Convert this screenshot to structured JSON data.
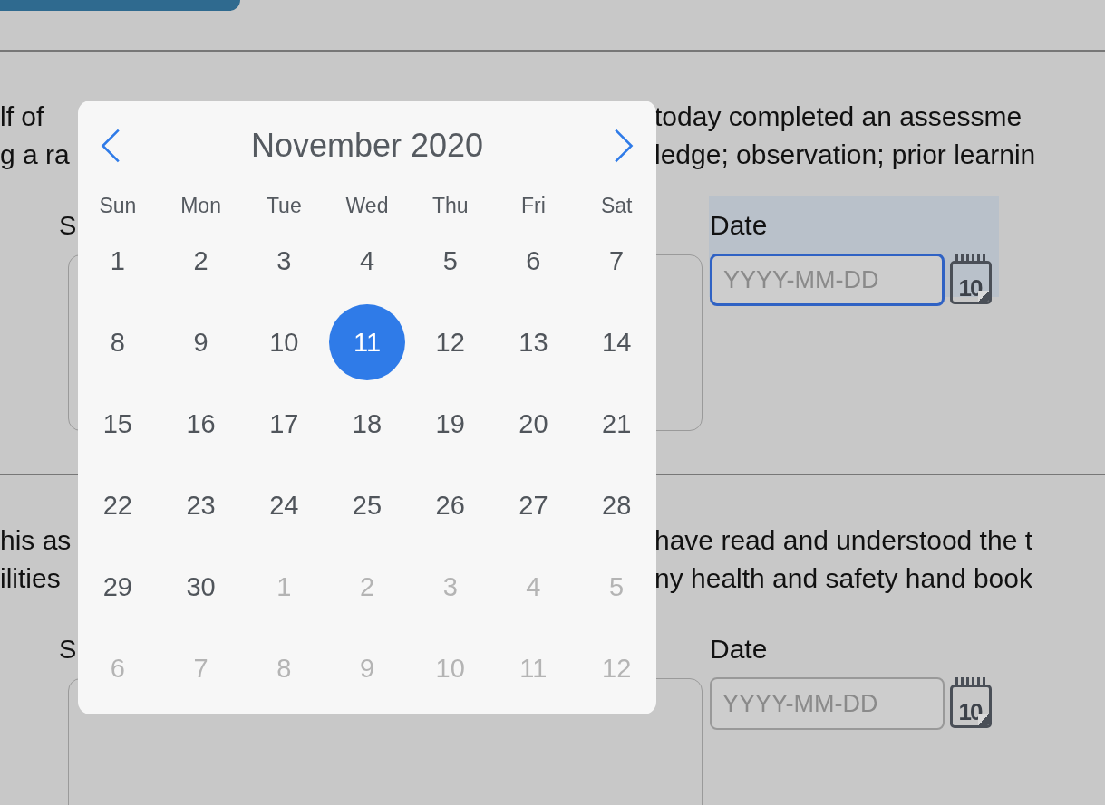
{
  "section_1": {
    "lines": [
      {
        "left": "lf of",
        "right": "today completed an assessme"
      },
      {
        "left": "g a ra",
        "right": "ledge; observation; prior learnin"
      }
    ],
    "signature_label": "S",
    "date": {
      "label": "Date",
      "placeholder": "YYYY-MM-DD",
      "focused": true,
      "icon_text": "10"
    }
  },
  "section_2": {
    "lines": [
      {
        "left": "his as",
        "right": "have read and understood the t"
      },
      {
        "left": "ilities",
        "right": "ny health and safety hand book"
      }
    ],
    "signature_label": "S",
    "date": {
      "label": "Date",
      "placeholder": "YYYY-MM-DD",
      "focused": false,
      "icon_text": "10"
    }
  },
  "calendar": {
    "title": "November 2020",
    "weekdays": [
      "Sun",
      "Mon",
      "Tue",
      "Wed",
      "Thu",
      "Fri",
      "Sat"
    ],
    "weeks": [
      [
        {
          "day": "1",
          "outside": false,
          "selected": false
        },
        {
          "day": "2",
          "outside": false,
          "selected": false
        },
        {
          "day": "3",
          "outside": false,
          "selected": false
        },
        {
          "day": "4",
          "outside": false,
          "selected": false
        },
        {
          "day": "5",
          "outside": false,
          "selected": false
        },
        {
          "day": "6",
          "outside": false,
          "selected": false
        },
        {
          "day": "7",
          "outside": false,
          "selected": false
        }
      ],
      [
        {
          "day": "8",
          "outside": false,
          "selected": false
        },
        {
          "day": "9",
          "outside": false,
          "selected": false
        },
        {
          "day": "10",
          "outside": false,
          "selected": false
        },
        {
          "day": "11",
          "outside": false,
          "selected": true
        },
        {
          "day": "12",
          "outside": false,
          "selected": false
        },
        {
          "day": "13",
          "outside": false,
          "selected": false
        },
        {
          "day": "14",
          "outside": false,
          "selected": false
        }
      ],
      [
        {
          "day": "15",
          "outside": false,
          "selected": false
        },
        {
          "day": "16",
          "outside": false,
          "selected": false
        },
        {
          "day": "17",
          "outside": false,
          "selected": false
        },
        {
          "day": "18",
          "outside": false,
          "selected": false
        },
        {
          "day": "19",
          "outside": false,
          "selected": false
        },
        {
          "day": "20",
          "outside": false,
          "selected": false
        },
        {
          "day": "21",
          "outside": false,
          "selected": false
        }
      ],
      [
        {
          "day": "22",
          "outside": false,
          "selected": false
        },
        {
          "day": "23",
          "outside": false,
          "selected": false
        },
        {
          "day": "24",
          "outside": false,
          "selected": false
        },
        {
          "day": "25",
          "outside": false,
          "selected": false
        },
        {
          "day": "26",
          "outside": false,
          "selected": false
        },
        {
          "day": "27",
          "outside": false,
          "selected": false
        },
        {
          "day": "28",
          "outside": false,
          "selected": false
        }
      ],
      [
        {
          "day": "29",
          "outside": false,
          "selected": false
        },
        {
          "day": "30",
          "outside": false,
          "selected": false
        },
        {
          "day": "1",
          "outside": true,
          "selected": false
        },
        {
          "day": "2",
          "outside": true,
          "selected": false
        },
        {
          "day": "3",
          "outside": true,
          "selected": false
        },
        {
          "day": "4",
          "outside": true,
          "selected": false
        },
        {
          "day": "5",
          "outside": true,
          "selected": false
        }
      ],
      [
        {
          "day": "6",
          "outside": true,
          "selected": false
        },
        {
          "day": "7",
          "outside": true,
          "selected": false
        },
        {
          "day": "8",
          "outside": true,
          "selected": false
        },
        {
          "day": "9",
          "outside": true,
          "selected": false
        },
        {
          "day": "10",
          "outside": true,
          "selected": false
        },
        {
          "day": "11",
          "outside": true,
          "selected": false
        },
        {
          "day": "12",
          "outside": true,
          "selected": false
        }
      ]
    ]
  }
}
